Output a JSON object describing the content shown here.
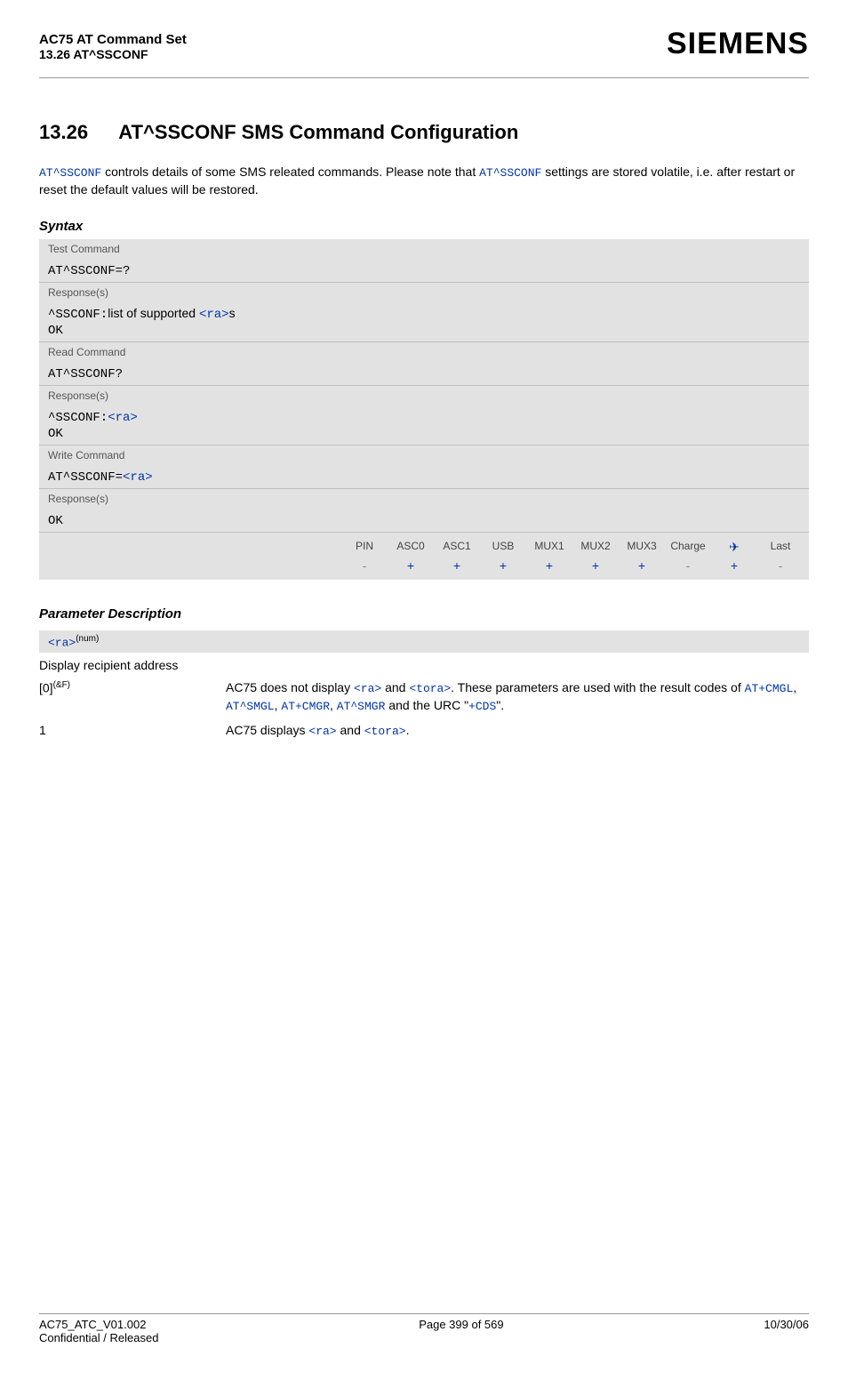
{
  "header": {
    "doc_title": "AC75 AT Command Set",
    "section_ref": "13.26 AT^SSCONF",
    "brand": "SIEMENS"
  },
  "section": {
    "number": "13.26",
    "title": "AT^SSCONF   SMS Command Configuration"
  },
  "intro": {
    "p1a": "AT^SSCONF",
    "p1b": " controls details of some SMS releated commands. Please note that ",
    "p1c": "AT^SSCONF",
    "p1d": " settings are stored volatile, i.e. after restart or reset the default values will be restored."
  },
  "syntax_heading": "Syntax",
  "syntax": {
    "test_label": "Test Command",
    "test_cmd": "AT^SSCONF=?",
    "test_resp_label": "Response(s)",
    "test_resp_a": "^SSCONF:",
    "test_resp_b": "list of supported ",
    "test_resp_c": "<ra>",
    "test_resp_d": "s",
    "test_resp_ok": "OK",
    "read_label": "Read Command",
    "read_cmd": "AT^SSCONF?",
    "read_resp_label": "Response(s)",
    "read_resp_a": "^SSCONF:",
    "read_resp_b": "<ra>",
    "read_resp_ok": "OK",
    "write_label": "Write Command",
    "write_cmd_a": "AT^SSCONF=",
    "write_cmd_b": "<ra>",
    "write_resp_label": "Response(s)",
    "write_resp_ok": "OK"
  },
  "feat": {
    "h": [
      "PIN",
      "ASC0",
      "ASC1",
      "USB",
      "MUX1",
      "MUX2",
      "MUX3",
      "Charge",
      "✈",
      "Last"
    ],
    "v": [
      "-",
      "+",
      "+",
      "+",
      "+",
      "+",
      "+",
      "-",
      "+",
      "-"
    ]
  },
  "param_heading": "Parameter Description",
  "param": {
    "name": "<ra>",
    "sup": "(num)",
    "desc": "Display recipient address",
    "row0_key": "[0]",
    "row0_sup": "(&F)",
    "row0_a": "AC75 does not display ",
    "row0_b": "<ra>",
    "row0_c": " and ",
    "row0_d": "<tora>",
    "row0_e": ". These parameters are used with the result codes of ",
    "row0_f": "AT+CMGL",
    "row0_g": ", ",
    "row0_h": "AT^SMGL",
    "row0_i": ", ",
    "row0_j": "AT+CMGR",
    "row0_k": ", ",
    "row0_l": "AT^SMGR",
    "row0_m": " and the URC \"",
    "row0_n": "+CDS",
    "row0_o": "\".",
    "row1_key": "1",
    "row1_a": "AC75 displays ",
    "row1_b": "<ra>",
    "row1_c": " and ",
    "row1_d": "<tora>",
    "row1_e": "."
  },
  "footer": {
    "left1": "AC75_ATC_V01.002",
    "left2": "Confidential / Released",
    "center": "Page 399 of 569",
    "right": "10/30/06"
  }
}
